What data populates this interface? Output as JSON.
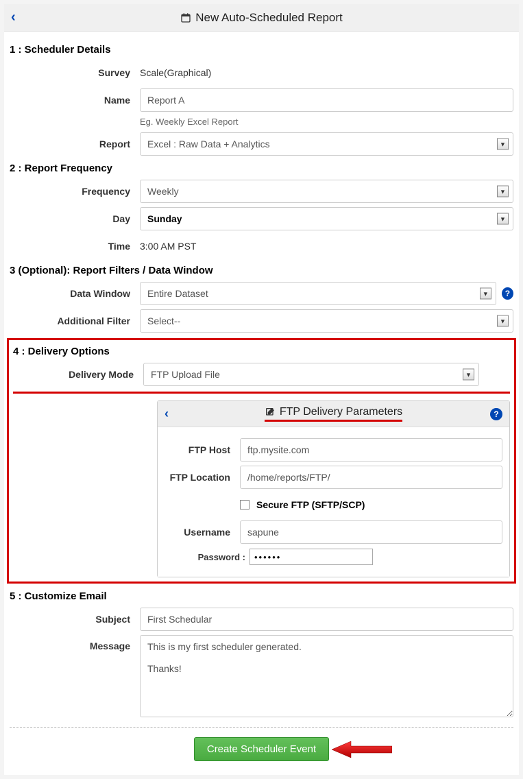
{
  "header": {
    "title": "New Auto-Scheduled Report"
  },
  "section1": {
    "heading": "1 : Scheduler Details",
    "survey_label": "Survey",
    "survey_value": "Scale(Graphical)",
    "name_label": "Name",
    "name_value": "Report A",
    "name_hint": "Eg. Weekly Excel Report",
    "report_label": "Report",
    "report_value": "Excel : Raw Data + Analytics"
  },
  "section2": {
    "heading": "2 : Report Frequency",
    "frequency_label": "Frequency",
    "frequency_value": "Weekly",
    "day_label": "Day",
    "day_value": "Sunday",
    "time_label": "Time",
    "time_value": "3:00 AM PST"
  },
  "section3": {
    "heading": "3 (Optional): Report Filters / Data Window",
    "data_window_label": "Data Window",
    "data_window_value": "Entire Dataset",
    "additional_filter_label": "Additional Filter",
    "additional_filter_value": "Select--"
  },
  "section4": {
    "heading": "4 : Delivery Options",
    "delivery_mode_label": "Delivery Mode",
    "delivery_mode_value": "FTP Upload File",
    "ftp_panel_title": "FTP Delivery Parameters",
    "ftp_host_label": "FTP Host",
    "ftp_host_value": "ftp.mysite.com",
    "ftp_location_label": "FTP Location",
    "ftp_location_value": "/home/reports/FTP/",
    "secure_label": "Secure FTP (SFTP/SCP)",
    "username_label": "Username",
    "username_value": "sapune",
    "password_label": "Password :",
    "password_value": "••••••"
  },
  "section5": {
    "heading": "5 : Customize Email",
    "subject_label": "Subject",
    "subject_value": "First Schedular",
    "message_label": "Message",
    "message_value": "This is my first scheduler generated.\n\nThanks!"
  },
  "footer": {
    "create_button": "Create Scheduler Event"
  }
}
